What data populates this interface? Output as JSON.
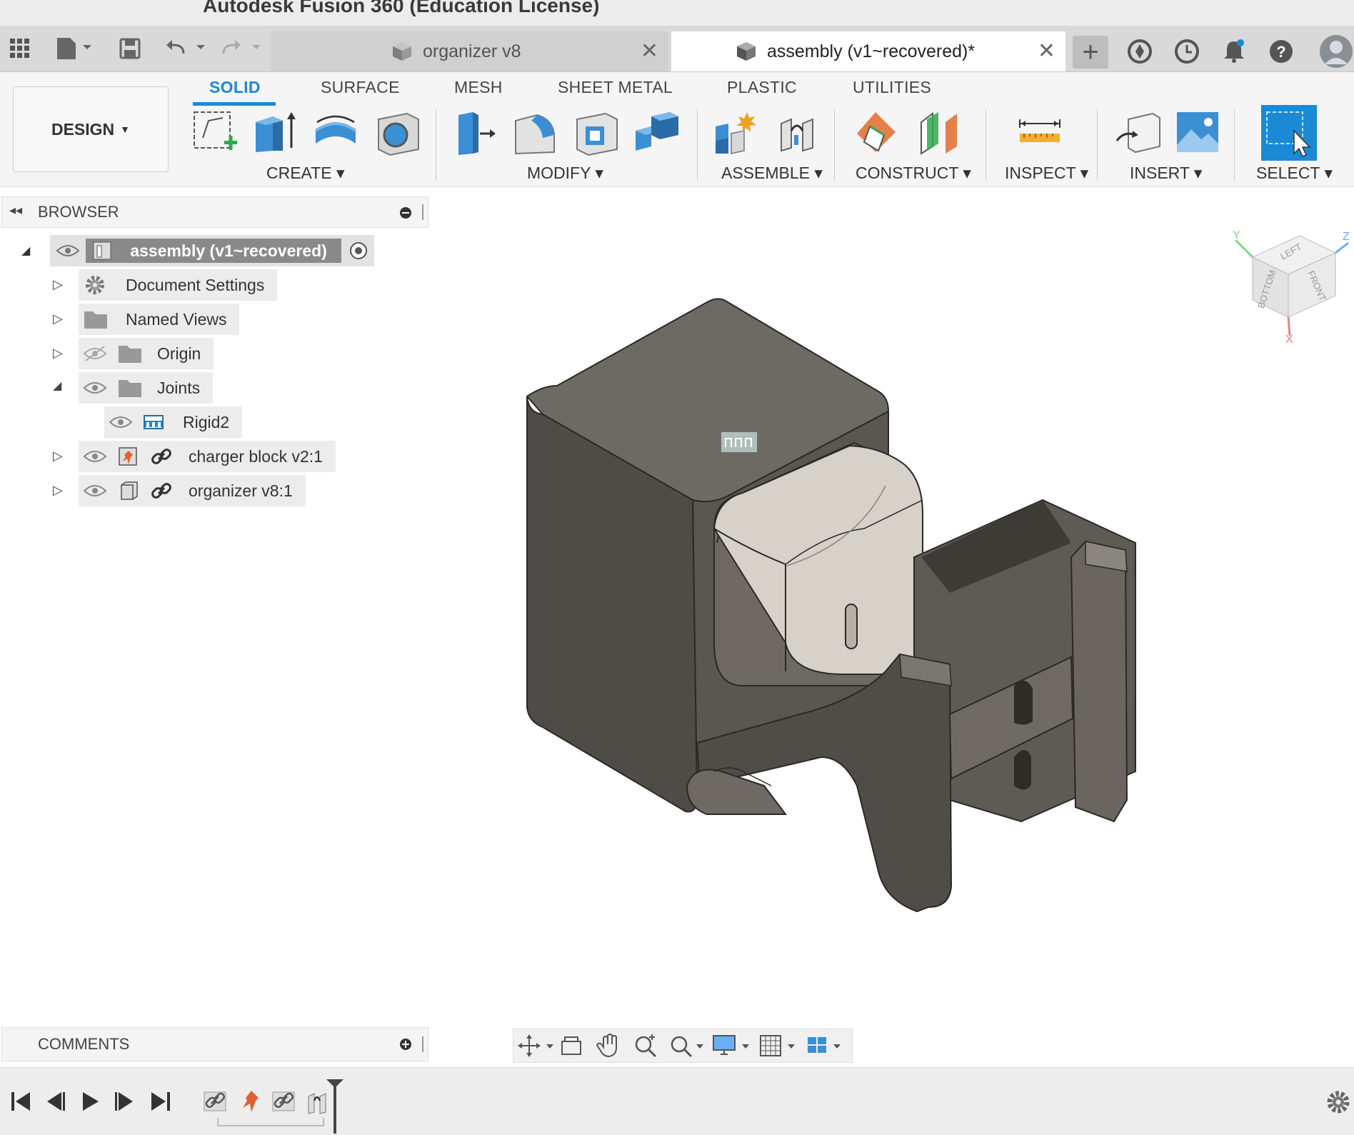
{
  "app": {
    "title": "Autodesk Fusion 360 (Education License)"
  },
  "tabs": [
    {
      "label": "organizer v8",
      "active": false
    },
    {
      "label": "assembly (v1~recovered)*",
      "active": true
    }
  ],
  "ribbon": {
    "workspace": "DESIGN",
    "tabs": [
      "SOLID",
      "SURFACE",
      "MESH",
      "SHEET METAL",
      "PLASTIC",
      "UTILITIES"
    ],
    "active_tab": "SOLID",
    "groups": [
      "CREATE",
      "MODIFY",
      "ASSEMBLE",
      "CONSTRUCT",
      "INSPECT",
      "INSERT",
      "SELECT"
    ]
  },
  "browser": {
    "title": "BROWSER",
    "root": "assembly (v1~recovered)",
    "items": [
      {
        "label": "Document Settings"
      },
      {
        "label": "Named Views"
      },
      {
        "label": "Origin"
      },
      {
        "label": "Joints"
      },
      {
        "label": "Rigid2"
      },
      {
        "label": "charger block v2:1"
      },
      {
        "label": "organizer v8:1"
      }
    ]
  },
  "comments": {
    "title": "COMMENTS"
  },
  "viewcube": {
    "faces": [
      "LEFT",
      "FRONT",
      "BOTTOM"
    ],
    "axes": [
      "Y",
      "Z",
      "X"
    ]
  },
  "colors": {
    "accent": "#1a8ad6",
    "model": "#5a5650",
    "part": "#d8d4cb"
  }
}
